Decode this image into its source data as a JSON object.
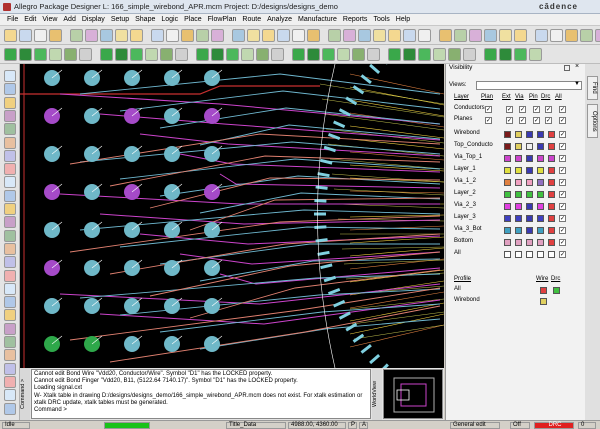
{
  "window": {
    "title": "Allegro Package Designer L: 166_simple_wirebond_APR.mcm  Project: D:/designs/designs_demo",
    "brand": "cādence"
  },
  "menu": [
    "File",
    "Edit",
    "View",
    "Add",
    "Display",
    "Setup",
    "Shape",
    "Logic",
    "Place",
    "FlowPlan",
    "Route",
    "Analyze",
    "Manufacture",
    "Reports",
    "Tools",
    "Help"
  ],
  "visibility": {
    "title": "Visibility",
    "views_label": "Views:",
    "views_value": "",
    "columns": [
      "Layer",
      "Plan",
      "Ext",
      "Via",
      "Pin",
      "Drc",
      "All"
    ],
    "global_rows": [
      {
        "label": "Conductors",
        "checks": [
          true,
          true,
          true,
          true,
          true,
          true
        ]
      },
      {
        "label": "Planes",
        "checks": [
          true,
          true,
          true,
          true,
          true,
          true
        ]
      }
    ],
    "layers": [
      {
        "label": "Wirebond",
        "colors": [
          "#7a1a1a",
          "#e0d060",
          "#3a3ab0",
          "#3a3ab0",
          "#e04040",
          "#ffffff"
        ]
      },
      {
        "label": "Top_Conducto",
        "colors": [
          "#7a1a1a",
          "#e0d060",
          "#f0f0f0",
          "#3a3ab0",
          "#e04040",
          "#ffffff"
        ]
      },
      {
        "label": "Via_Top_1",
        "colors": [
          "#cc44cc",
          "#cc44cc",
          "#3a3ab0",
          "#cc44cc",
          "#cc44cc",
          "#ffffff"
        ]
      },
      {
        "label": "Layer_1",
        "colors": [
          "#e0e040",
          "#e0e040",
          "#3a3ab0",
          "#e0e040",
          "#e04040",
          "#ffffff"
        ]
      },
      {
        "label": "Via_1_2",
        "colors": [
          "#e08040",
          "#f0a0c0",
          "#f0a0c0",
          "#9070c0",
          "#e04040",
          "#ffffff"
        ]
      },
      {
        "label": "Layer_2",
        "colors": [
          "#40c040",
          "#40c040",
          "#40c040",
          "#40c040",
          "#e04040",
          "#ffffff"
        ]
      },
      {
        "label": "Via_2_3",
        "colors": [
          "#e040e0",
          "#e040e0",
          "#3a3ab0",
          "#e040e0",
          "#e04040",
          "#ffffff"
        ]
      },
      {
        "label": "Layer_3",
        "colors": [
          "#4040c0",
          "#4040c0",
          "#3a3ab0",
          "#4040c0",
          "#e04040",
          "#ffffff"
        ]
      },
      {
        "label": "Via_3_Bot",
        "colors": [
          "#40a0c0",
          "#40a0c0",
          "#3a3ab0",
          "#40a0c0",
          "#e04040",
          "#ffffff"
        ]
      },
      {
        "label": "Bottom",
        "colors": [
          "#e0a0c0",
          "#e0a0c0",
          "#e0a0c0",
          "#e0a0c0",
          "#e04040",
          "#ffffff"
        ]
      },
      {
        "label": "All",
        "colors": [
          "#ffffff",
          "#ffffff",
          "#ffffff",
          "#ffffff",
          "#ffffff",
          "#ffffff"
        ]
      }
    ],
    "profile_header": "Profile",
    "profile_cols": [
      "Wire",
      "Drc"
    ],
    "profiles": [
      {
        "label": "All",
        "colors": [
          "#e04040",
          "#40c040"
        ]
      },
      {
        "label": "Wirebond",
        "colors": [
          "#e0d060"
        ]
      }
    ]
  },
  "side_tabs": [
    "Find",
    "Options"
  ],
  "command": {
    "label": "Command >",
    "lines": [
      "Cannot edit Bond Wire \"Vdd20, Conductor/Wire\". Symbol \"D1\" has the LOCKED property.",
      "Cannot edit Bond Finger \"Vdd20, B11, (5122.64 7140.17)\". Symbol \"D1\" has the LOCKED property.",
      "Loading signal.cxt",
      "W- Xtalk table in drawing D:/designs/designs_demo/166_simple_wirebond_APR.mcm does not exist. For xtalk estimation or",
      "xtalk DRC update, xtalk tables must be generated.",
      "Command >"
    ]
  },
  "worldview": {
    "label": "WorldView"
  },
  "status": {
    "left": "Idle",
    "layer": "Title_Data",
    "coords": "4988.00, 4360.00",
    "p_label": "P",
    "a_label": "A",
    "mode": "General edit",
    "state": "Off",
    "drc": "DRC",
    "count": "0",
    "status_green": "#19c219",
    "status_red": "#e02020"
  }
}
